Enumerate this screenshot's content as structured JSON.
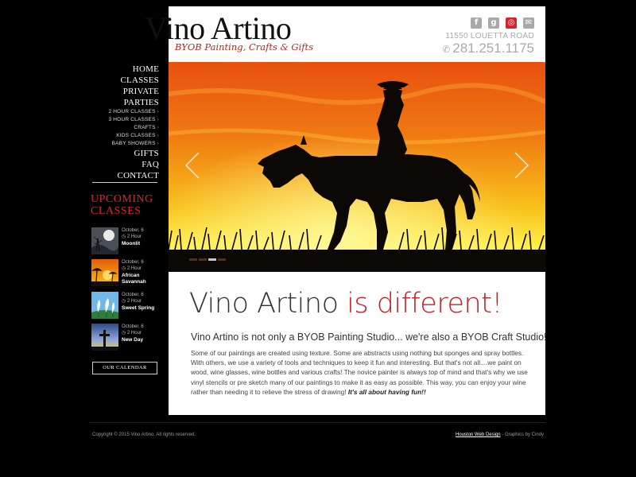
{
  "brand": {
    "name": "Vino Artino",
    "tagline": "BYOB Painting, Crafts & Gifts",
    "accent": "#c91d24"
  },
  "header": {
    "social_icons": [
      "facebook-icon",
      "google-plus-icon",
      "instagram-icon",
      "email-icon"
    ],
    "address": "11550 LOUETTA ROAD",
    "phone": "281.251.1175"
  },
  "nav": {
    "items": [
      {
        "label": "HOME",
        "level": 1
      },
      {
        "label": "CLASSES",
        "level": 1
      },
      {
        "label": "PRIVATE PARTIES",
        "level": 1
      },
      {
        "label": "2 HOUR CLASSES",
        "level": 2
      },
      {
        "label": "3 HOUR CLASSES",
        "level": 2
      },
      {
        "label": "CRAFTS",
        "level": 2
      },
      {
        "label": "KIDS CLASSES",
        "level": 2
      },
      {
        "label": "BABY SHOWERS",
        "level": 2
      },
      {
        "label": "GIFTS",
        "level": 1
      },
      {
        "label": "FAQ",
        "level": 1
      },
      {
        "label": "CONTACT",
        "level": 1
      }
    ]
  },
  "upcoming": {
    "title": "UPCOMING CLASSES",
    "classes": [
      {
        "date": "October, 6",
        "duration": "2 Hour",
        "name": "Moonlit"
      },
      {
        "date": "October, 6",
        "duration": "2 Hour",
        "name": "African Savannah"
      },
      {
        "date": "October, 6",
        "duration": "2 Hour",
        "name": "Sweet Spring"
      },
      {
        "date": "October, 6",
        "duration": "2 Hour",
        "name": "New Day"
      }
    ],
    "calendar_button": "OUR CALENDAR"
  },
  "slider": {
    "slide_count": 4,
    "active_index": 2
  },
  "main": {
    "headline_part1": "Vino Artino ",
    "headline_part2": "is different!",
    "subheadline": "Vino Artino is not only a BYOB Painting Studio... we're also a BYOB Craft Studio!",
    "body": "Some of our paintings are created using texture.  Some are abstracts using nothing but sponges and spray bottles.  With others, we use a variety of tools and techniques to keep it fun and interesting.  But that's not all....we paint on wood, wine glasses, wine bottles and various crafts!   The novice painter is always top of mind and that's why we use vinyl stencils or pre sketch many of our paintings to make it as easy as possible.  This way, you can enjoy your wine rather than needing it to relieve the stress of drawing!  ",
    "body_emphasis": "It's all about having fun!!"
  },
  "footer": {
    "copyright": "Copyright © 2015 Vino Artino. All rights reserved.",
    "design_link": "Houston Web Design",
    "graphics_credit": " - Graphics by Cindy"
  }
}
